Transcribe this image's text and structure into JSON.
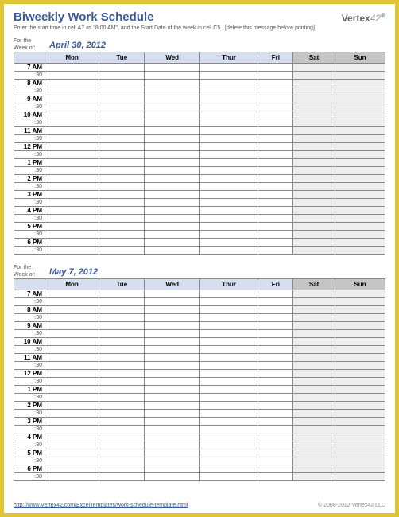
{
  "header": {
    "title": "Biweekly Work Schedule",
    "instruction": "Enter the start time in cell A7 as \"8:00 AM\", and the Start Date of the week in cell C5 . [delete this message before printing]",
    "logo_main": "Vertex",
    "logo_num": "42"
  },
  "week_label": "For the Week of:",
  "weeks": [
    {
      "date": "April 30, 2012"
    },
    {
      "date": "May 7, 2012"
    }
  ],
  "days": [
    "Mon",
    "Tue",
    "Wed",
    "Thur",
    "Fri",
    "Sat",
    "Sun"
  ],
  "time_slots": [
    {
      "hour": "7 AM",
      "half": ":30"
    },
    {
      "hour": "8 AM",
      "half": ":30"
    },
    {
      "hour": "9 AM",
      "half": ":30"
    },
    {
      "hour": "10 AM",
      "half": ":30"
    },
    {
      "hour": "11 AM",
      "half": ":30"
    },
    {
      "hour": "12 PM",
      "half": ":30"
    },
    {
      "hour": "1 PM",
      "half": ":30"
    },
    {
      "hour": "2 PM",
      "half": ":30"
    },
    {
      "hour": "3 PM",
      "half": ":30"
    },
    {
      "hour": "4 PM",
      "half": ":30"
    },
    {
      "hour": "5 PM",
      "half": ":30"
    },
    {
      "hour": "6 PM",
      "half": ":30"
    }
  ],
  "footer": {
    "link": "http://www.Vertex42.com/ExcelTemplates/work-schedule-template.html",
    "copyright": "© 2008-2012 Vertex42 LLC"
  }
}
